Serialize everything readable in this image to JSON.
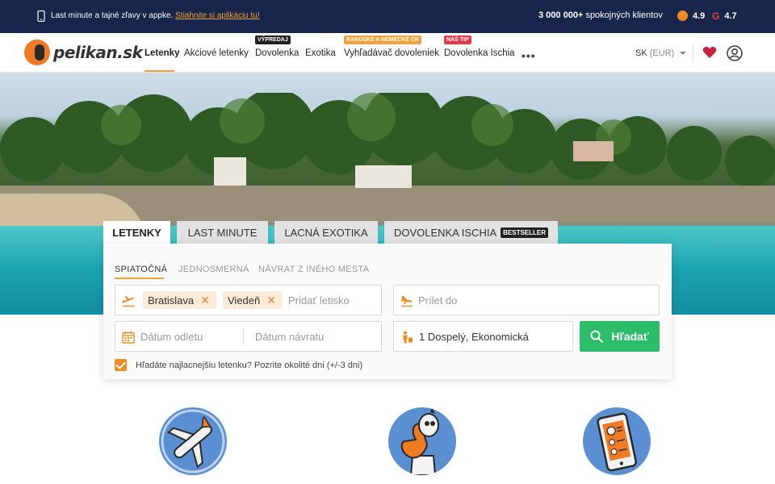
{
  "topbar": {
    "promo_text": "Last minute a tajné zľavy v appke.",
    "promo_link": "Stiahnite si aplikáciu tu!",
    "clients_count": "3 000 000+",
    "clients_text": "spokojných klientov",
    "rating_app": "4.9",
    "rating_google": "4.7"
  },
  "header": {
    "logo_text": "pelikan.sk",
    "nav": [
      {
        "label": "Letenky"
      },
      {
        "label": "Akciové letenky"
      },
      {
        "label": "Dovolenka",
        "badge": "VÝPREDAJ"
      },
      {
        "label": "Exotika"
      },
      {
        "label": "Vyhľadávač dovoleniek",
        "badge": "RAKÚSKE A NEMECKÉ CK"
      },
      {
        "label": "Dovolenka Ischia",
        "badge": "NÁŠ TIP"
      }
    ],
    "more_label": "•••",
    "lang": "SK",
    "currency": "(EUR)",
    "colors": {
      "badge_dark": "#222222",
      "badge_yellow": "#f5a13a",
      "badge_red": "#e23b4a",
      "accent": "#f5a13a"
    }
  },
  "search": {
    "tabs": [
      {
        "label": "LETENKY"
      },
      {
        "label": "LAST MINUTE"
      },
      {
        "label": "LACNÁ EXOTIKA"
      },
      {
        "label": "DOVOLENKA ISCHIA",
        "badge": "BESTSELLER"
      }
    ],
    "trip_types": [
      "SPIATOČNÁ",
      "JEDNOSMERNÁ",
      "NÁVRAT Z INÉHO MESTA"
    ],
    "from_chips": [
      "Bratislava",
      "Viedeň"
    ],
    "from_placeholder": "Pridať letisko",
    "to_placeholder": "Prílet do",
    "depart_placeholder": "Dátum odletu",
    "return_placeholder": "Dátum návratu",
    "passengers_value": "1 Dospelý, Ekonomická",
    "search_button": "Hľadať",
    "flexible_dates_label": "Hľadáte najlacnejšiu letenku? Pozrite okolité dni (+/-3 dni)",
    "flexible_dates_checked": true,
    "colors": {
      "search_button": "#2bbd6a",
      "chip_bg": "#fdebd7",
      "checkbox": "#f08a23"
    }
  },
  "features": [
    {
      "icon": "airplane-icon"
    },
    {
      "icon": "pelican-mascot-icon"
    },
    {
      "icon": "tablet-deals-icon"
    }
  ]
}
